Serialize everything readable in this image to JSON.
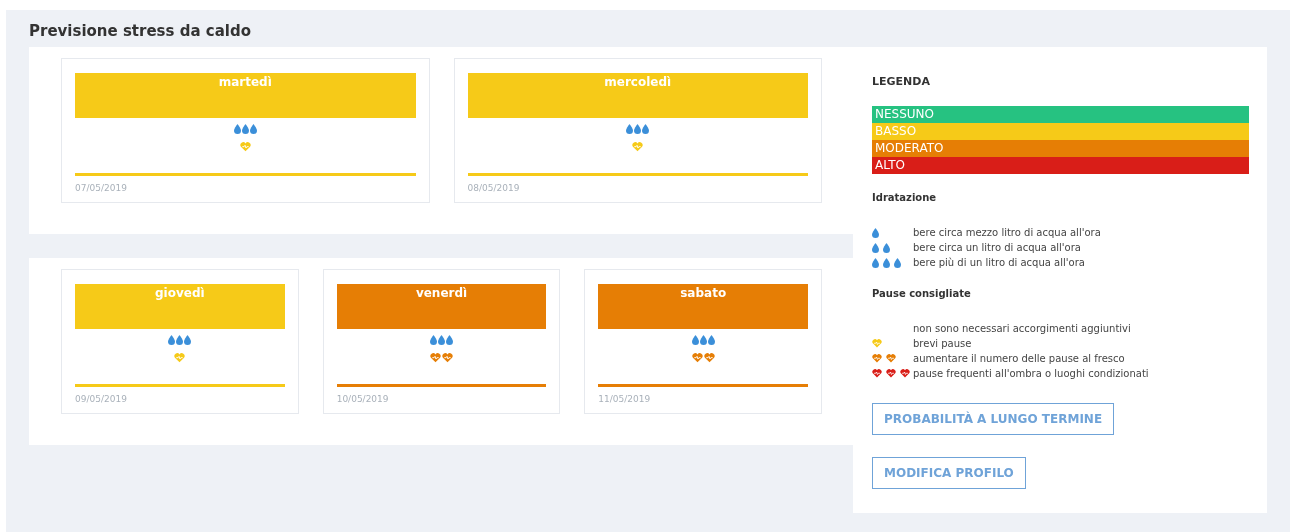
{
  "title": "Previsione stress da caldo",
  "rows": [
    {
      "days": [
        {
          "name": "martedì",
          "date": "07/05/2019",
          "color": "#f6ca18",
          "hydration": {
            "kind": "high"
          },
          "pauses": {
            "kind": "low"
          }
        },
        {
          "name": "mercoledì",
          "date": "08/05/2019",
          "color": "#f6ca18",
          "hydration": {
            "kind": "high"
          },
          "pauses": {
            "kind": "low"
          }
        }
      ]
    },
    {
      "days": [
        {
          "name": "giovedì",
          "date": "09/05/2019",
          "color": "#f6ca18",
          "hydration": {
            "kind": "high"
          },
          "pauses": {
            "kind": "low"
          }
        },
        {
          "name": "venerdì",
          "date": "10/05/2019",
          "color": "#e67e05",
          "hydration": {
            "kind": "high"
          },
          "pauses": {
            "kind": "moderate"
          }
        },
        {
          "name": "sabato",
          "date": "11/05/2019",
          "color": "#e67e05",
          "hydration": {
            "kind": "high"
          },
          "pauses": {
            "kind": "moderate"
          }
        }
      ]
    }
  ],
  "legend": {
    "title": "LEGENDA",
    "levels": [
      {
        "label": "NESSUNO",
        "color": "#26c281"
      },
      {
        "label": "BASSO",
        "color": "#f6ca18"
      },
      {
        "label": "MODERATO",
        "color": "#e67e05"
      },
      {
        "label": "ALTO",
        "color": "#d91e18"
      }
    ],
    "hydration": {
      "title": "Idratazione",
      "items": [
        {
          "kind": "low",
          "text": "bere circa mezzo litro di acqua all'ora"
        },
        {
          "kind": "medium",
          "text": "bere circa un litro di acqua all'ora"
        },
        {
          "kind": "high",
          "text": "bere più di un litro di acqua all'ora"
        }
      ]
    },
    "pauses": {
      "title": "Pause consigliate",
      "items": [
        {
          "kind": "none",
          "text": "non sono necessari accorgimenti aggiuntivi"
        },
        {
          "kind": "low",
          "text": "brevi pause"
        },
        {
          "kind": "moderate",
          "text": "aumentare il numero delle pause al fresco"
        },
        {
          "kind": "high",
          "text": "pause frequenti all'ombra o luoghi condizionati"
        }
      ]
    },
    "buttons": [
      "PROBABILITÀ A LUNGO TERMINE",
      "MODIFICA PROFILO"
    ]
  }
}
